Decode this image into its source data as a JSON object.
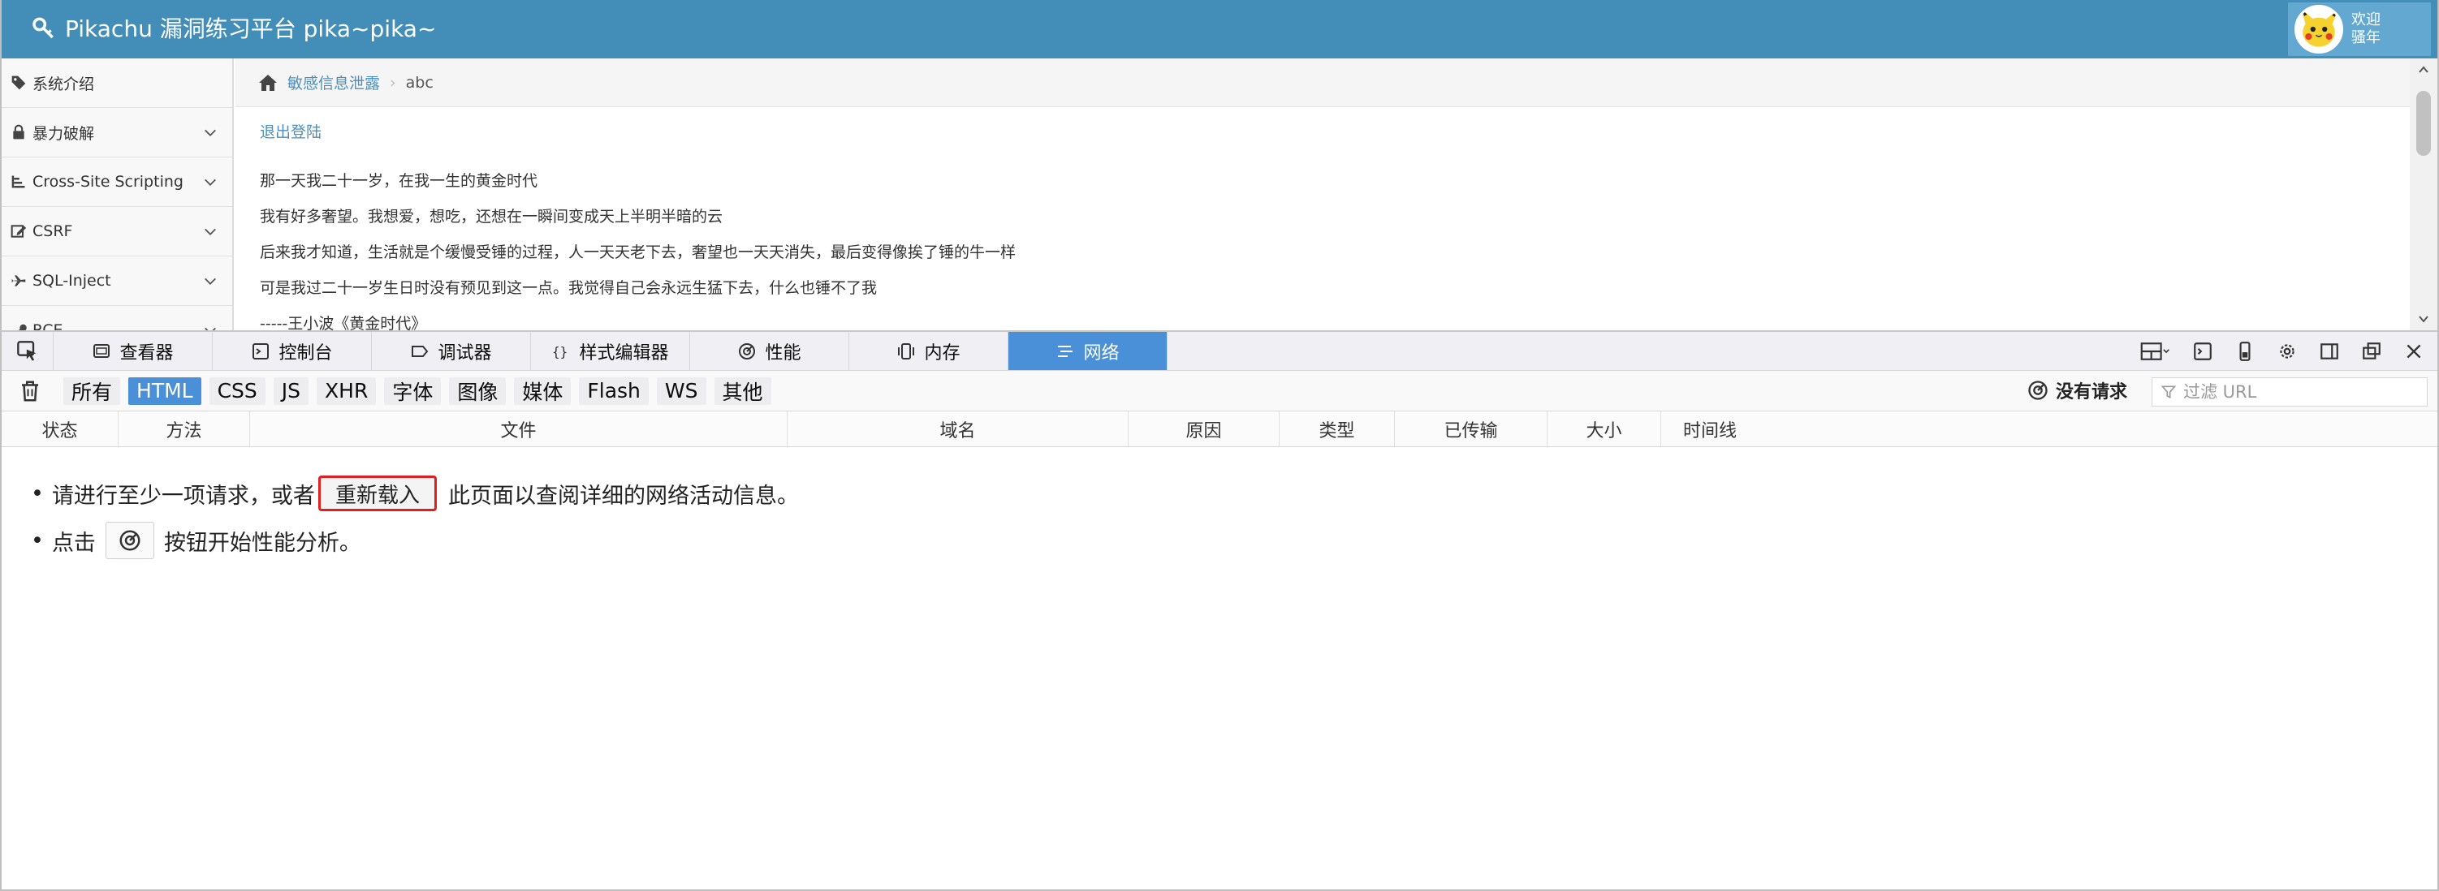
{
  "site": {
    "brand": "Pikachu 漏洞练习平台 pika~pika~",
    "welcome_line1": "欢迎",
    "welcome_line2": "骚年"
  },
  "sidebar": {
    "items": [
      {
        "label": "系统介绍",
        "icon": "tag-icon",
        "has_chevron": false
      },
      {
        "label": "暴力破解",
        "icon": "lock-icon",
        "has_chevron": true
      },
      {
        "label": "Cross-Site Scripting",
        "icon": "tree-icon",
        "has_chevron": true
      },
      {
        "label": "CSRF",
        "icon": "edit-icon",
        "has_chevron": true
      },
      {
        "label": "SQL-Inject",
        "icon": "plane-icon",
        "has_chevron": true
      },
      {
        "label": "RCE",
        "icon": "wrench-icon",
        "has_chevron": true
      }
    ]
  },
  "breadcrumb": {
    "section": "敏感信息泄露",
    "current": "abc"
  },
  "content": {
    "logout": "退出登陆",
    "lines": [
      "那一天我二十一岁，在我一生的黄金时代",
      "我有好多奢望。我想爱，想吃，还想在一瞬间变成天上半明半暗的云",
      "后来我才知道，生活就是个缓慢受锤的过程，人一天天老下去，奢望也一天天消失，最后变得像挨了锤的牛一样",
      "可是我过二十一岁生日时没有预见到这一点。我觉得自己会永远生猛下去，什么也锤不了我",
      "-----王小波《黄金时代》"
    ]
  },
  "devtools": {
    "tabs": [
      {
        "label": "查看器",
        "icon": "inspector-icon",
        "active": false
      },
      {
        "label": "控制台",
        "icon": "console-icon",
        "active": false
      },
      {
        "label": "调试器",
        "icon": "debugger-icon",
        "active": false
      },
      {
        "label": "样式编辑器",
        "icon": "style-editor-icon",
        "active": false
      },
      {
        "label": "性能",
        "icon": "performance-icon",
        "active": false
      },
      {
        "label": "内存",
        "icon": "memory-icon",
        "active": false
      },
      {
        "label": "网络",
        "icon": "network-icon",
        "active": true
      }
    ],
    "filters": [
      "所有",
      "HTML",
      "CSS",
      "JS",
      "XHR",
      "字体",
      "图像",
      "媒体",
      "Flash",
      "WS",
      "其他"
    ],
    "active_filter": "HTML",
    "status": "没有请求",
    "filter_placeholder": "过滤 URL",
    "columns": [
      "状态",
      "方法",
      "文件",
      "域名",
      "原因",
      "类型",
      "已传输",
      "大小",
      "时间线"
    ],
    "notice": {
      "line1_before": "请进行至少一项请求，或者",
      "reload_label": "重新载入",
      "line1_after": "此页面以查阅详细的网络活动信息。",
      "line2_before": "点击",
      "line2_after": "按钮开始性能分析。"
    }
  },
  "colors": {
    "topbar": "#438eb9",
    "devtools_active_tab": "#4a90d9",
    "highlight_border": "#e02020",
    "link": "#4c8fbd"
  }
}
